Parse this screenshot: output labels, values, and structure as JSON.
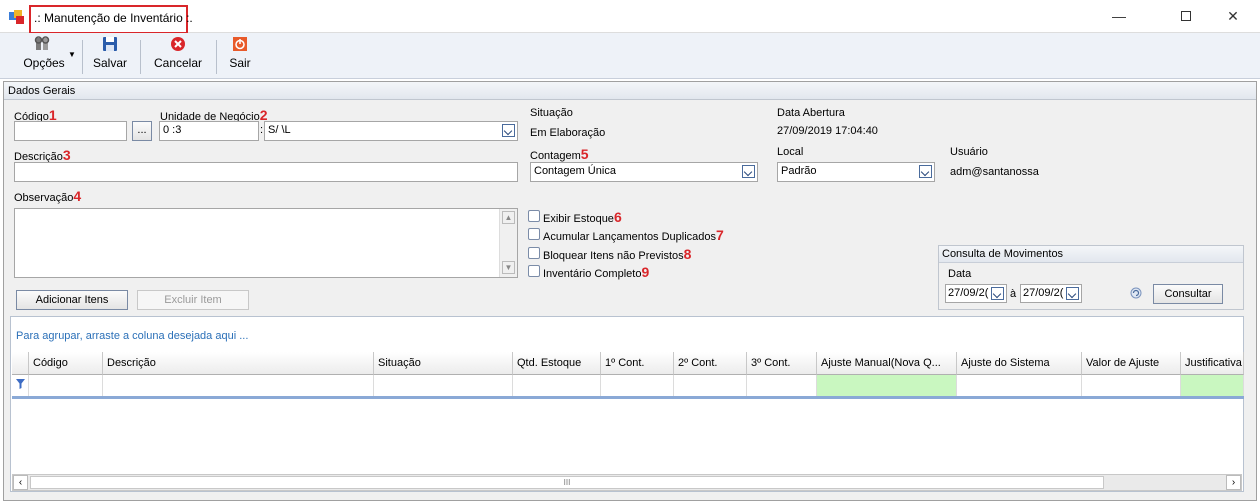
{
  "window": {
    "title": ".: Manutenção de Inventário :."
  },
  "toolbar": {
    "opcoes": "Opções",
    "salvar": "Salvar",
    "cancelar": "Cancelar",
    "sair": "Sair"
  },
  "section": {
    "title": "Dados Gerais"
  },
  "form": {
    "codigo_label": "Código",
    "codigo_value": "",
    "browse_label": "...",
    "unidade_label": "Unidade de Negócio",
    "unidade_code": "0          :3",
    "unidade_name": "S/                                           \\L",
    "descricao_label": "Descrição",
    "descricao_value": "",
    "observacao_label": "Observação",
    "observacao_value": "",
    "situacao_label": "Situação",
    "situacao_value": "Em Elaboração",
    "data_abertura_label": "Data Abertura",
    "data_abertura_value": "27/09/2019 17:04:40",
    "contagem_label": "Contagem",
    "contagem_value": "Contagem Única",
    "local_label": "Local",
    "local_value": "Padrão",
    "usuario_label": "Usuário",
    "usuario_value": "adm@santanossa",
    "exibir_estoque": "Exibir Estoque",
    "acumular": "Acumular Lançamentos Duplicados",
    "bloquear": "Bloquear Itens não Previstos",
    "inventario_completo": "Inventário Completo",
    "adicionar_itens": "Adicionar Itens",
    "excluir_item": "Excluir Item"
  },
  "markers": {
    "m1": "1",
    "m2": "2",
    "m3": "3",
    "m4": "4",
    "m5": "5",
    "m6": "6",
    "m7": "7",
    "m8": "8",
    "m9": "9"
  },
  "movimentos": {
    "title": "Consulta de Movimentos",
    "data_label": "Data",
    "date_from": "27/09/2(",
    "separator": "à",
    "date_to": "27/09/2(",
    "consultar": "Consultar"
  },
  "grid": {
    "group_hint": "Para agrupar, arraste a coluna desejada aqui ...",
    "columns": [
      "Código",
      "Descrição",
      "Situação",
      "Qtd. Estoque",
      "1º Cont.",
      "2º Cont.",
      "3º Cont.",
      "Ajuste Manual(Nova Q...",
      "Ajuste do Sistema",
      "Valor de Ajuste",
      "Justificativa"
    ],
    "scroll_grip": "III"
  },
  "colors": {
    "marker": "#d9262a",
    "green_filter": "#c9f7c0",
    "hint_blue": "#2b70b8"
  }
}
